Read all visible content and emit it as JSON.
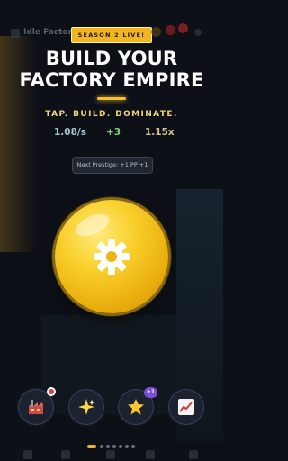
{
  "header": {
    "app_title": "Idle Factory",
    "season_badge": "SEASON 2 LIVE!"
  },
  "hero": {
    "headline_line1": "BUILD YOUR",
    "headline_line2": "FACTORY EMPIRE",
    "tagline": "TAP. BUILD. DOMINATE."
  },
  "stats": {
    "rate": "1.08/s",
    "click_gain": "+3",
    "multiplier": "1.15x"
  },
  "prestige": {
    "label": "Next Prestige: +1 PP   +1"
  },
  "actions": {
    "main_button_icon": "gear-icon",
    "buttons": [
      {
        "icon": "factory-icon"
      },
      {
        "icon": "sparkle-icon"
      },
      {
        "icon": "star-icon",
        "badge": "+1"
      },
      {
        "icon": "trend-chart-icon"
      }
    ]
  },
  "pager": {
    "count": 7,
    "active": 0
  },
  "colors": {
    "accent": "#f2b51f",
    "background": "#0d1016",
    "tagline": "#efd27a",
    "rate": "#a9c3d6",
    "click": "#7fd07a",
    "multiplier": "#d6c48a"
  }
}
